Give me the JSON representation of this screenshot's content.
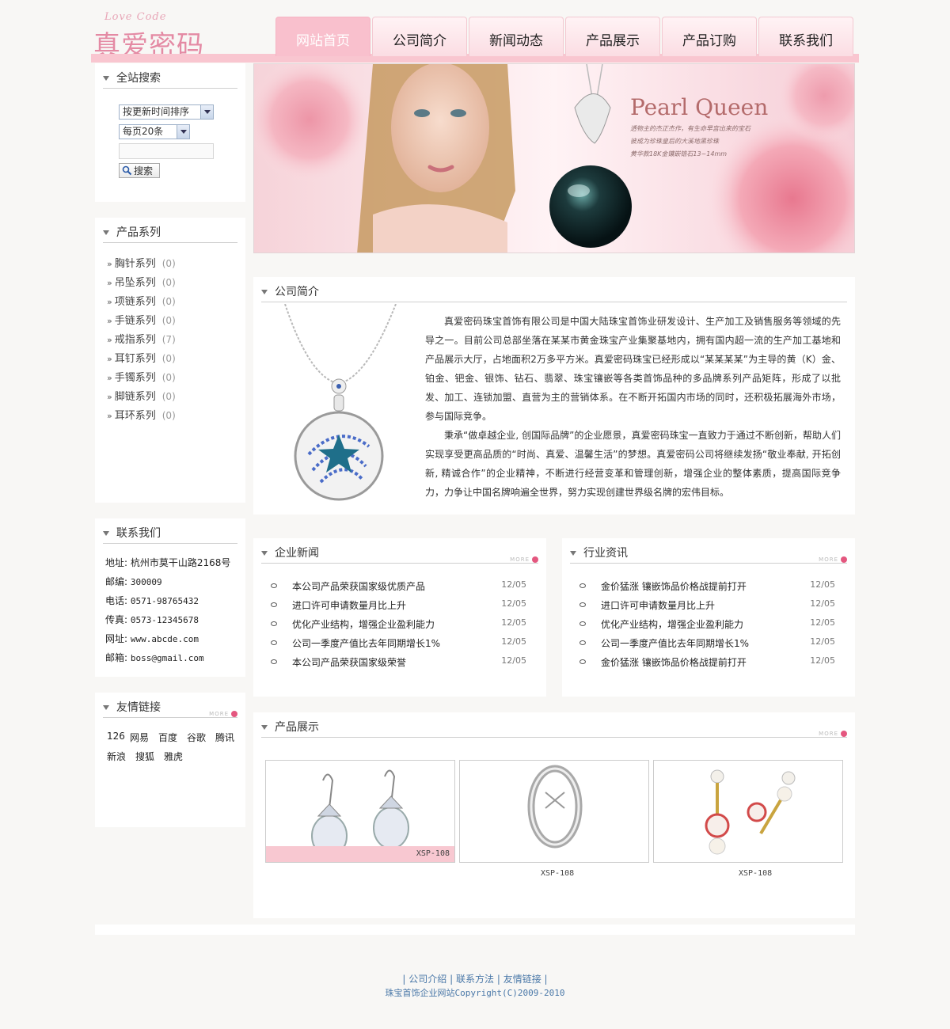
{
  "header": {
    "logo_script": "Love Code",
    "logo_cn": "真爱密码"
  },
  "nav": {
    "items": [
      "网站首页",
      "公司简介",
      "新闻动态",
      "产品展示",
      "产品订购",
      "联系我们"
    ],
    "active": 0
  },
  "banner": {
    "title": "Pearl Queen",
    "lines": [
      "透物主的杰正杰作，有生命早宫出来的宝石",
      "彼成为珍珠皇后的大溪地黑珍珠",
      "黄华款18K金镶嵌锆石13~14mm"
    ]
  },
  "search": {
    "title": "全站搜索",
    "sort_select": "按更新时间排序",
    "perpage_select": "每页20条",
    "keyword_value": "",
    "button": "搜索"
  },
  "categories": {
    "title": "产品系列",
    "items": [
      {
        "name": "胸针系列",
        "count": "(0)"
      },
      {
        "name": "吊坠系列",
        "count": "(0)"
      },
      {
        "name": "项链系列",
        "count": "(0)"
      },
      {
        "name": "手链系列",
        "count": "(0)"
      },
      {
        "name": "戒指系列",
        "count": "(7)"
      },
      {
        "name": "耳钉系列",
        "count": "(0)"
      },
      {
        "name": "手镯系列",
        "count": "(0)"
      },
      {
        "name": "脚链系列",
        "count": "(0)"
      },
      {
        "name": "耳环系列",
        "count": "(0)"
      }
    ]
  },
  "contact": {
    "title": "联系我们",
    "rows": [
      {
        "label": "地址:",
        "value": "杭州市莫干山路2168号"
      },
      {
        "label": "邮编:",
        "value": "300009"
      },
      {
        "label": "电话:",
        "value": "0571-98765432"
      },
      {
        "label": "传真:",
        "value": "0573-12345678"
      },
      {
        "label": "网址:",
        "value": "www.abcde.com"
      },
      {
        "label": "邮箱:",
        "value": "boss@gmail.com"
      }
    ]
  },
  "friends": {
    "title": "友情链接",
    "more": "MORE",
    "links": [
      "126",
      "网易",
      "百度",
      "谷歌",
      "腾讯",
      "新浪",
      "搜狐",
      "雅虎"
    ]
  },
  "intro": {
    "title": "公司简介",
    "paragraphs": [
      "真爱密码珠宝首饰有限公司是中国大陆珠宝首饰业研发设计、生产加工及销售服务等领域的先导之一。目前公司总部坐落在某某市黄金珠宝产业集聚基地内，拥有国内超一流的生产加工基地和产品展示大厅，占地面积2万多平方米。真爱密码珠宝已经形成以“某某某某”为主导的黄（K）金、铂金、钯金、银饰、钻石、翡翠、珠宝镶嵌等各类首饰品种的多品牌系列产品矩阵，形成了以批发、加工、连锁加盟、直营为主的营销体系。在不断开拓国内市场的同时，还积极拓展海外市场，参与国际竞争。",
      "秉承“做卓越企业, 创国际品牌”的企业愿景，真爱密码珠宝一直致力于通过不断创新，帮助人们实现享受更高品质的“时尚、真爱、温馨生活”的梦想。真爱密码公司将继续发扬“敬业奉献, 开拓创新, 精诚合作”的企业精神，不断进行经营变革和管理创新，增强企业的整体素质，提高国际竞争力，力争让中国名牌响遍全世界，努力实现创建世界级名牌的宏伟目标。"
    ]
  },
  "company_news": {
    "title": "企业新闻",
    "more": "MORE",
    "items": [
      {
        "title": "本公司产品荣获国家级优质产品",
        "date": "12/05"
      },
      {
        "title": "进口许可申请数量月比上升",
        "date": "12/05"
      },
      {
        "title": "优化产业结构，增强企业盈利能力",
        "date": "12/05"
      },
      {
        "title": "公司一季度产值比去年同期增长1%",
        "date": "12/05"
      },
      {
        "title": "本公司产品荣获国家级荣誉",
        "date": "12/05"
      }
    ]
  },
  "industry_news": {
    "title": "行业资讯",
    "more": "MORE",
    "items": [
      {
        "title": "金价猛涨 镶嵌饰品价格战提前打开",
        "date": "12/05"
      },
      {
        "title": "进口许可申请数量月比上升",
        "date": "12/05"
      },
      {
        "title": "优化产业结构，增强企业盈利能力",
        "date": "12/05"
      },
      {
        "title": "公司一季度产值比去年同期增长1%",
        "date": "12/05"
      },
      {
        "title": "金价猛涨 镶嵌饰品价格战提前打开",
        "date": "12/05"
      }
    ]
  },
  "products": {
    "title": "产品展示",
    "more": "MORE",
    "items": [
      {
        "code": "XSP-108"
      },
      {
        "code": "XSP-108"
      },
      {
        "code": "XSP-108"
      }
    ]
  },
  "footer": {
    "links": [
      "公司介绍",
      "联系方法",
      "友情链接"
    ],
    "copyright": "珠宝首饰企业网站Copyright(C)2009-2010"
  },
  "colors": {
    "pink": "#f9c6d0",
    "active_tab": "#f9c0cd",
    "footer_link": "#4a78a8"
  }
}
